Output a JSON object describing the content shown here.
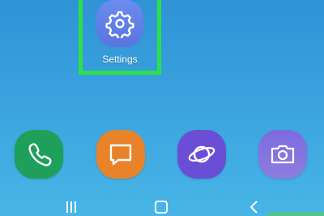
{
  "home_screen": {
    "settings_app": {
      "label": "Settings",
      "icon": "gear-icon"
    },
    "dock": [
      {
        "name": "phone",
        "icon": "phone-icon",
        "color": "#1fa05a"
      },
      {
        "name": "messages",
        "icon": "message-icon",
        "color": "#e8832a"
      },
      {
        "name": "internet",
        "icon": "planet-icon",
        "color": "#6a4fd6"
      },
      {
        "name": "camera",
        "icon": "camera-icon",
        "color": "#7b6be0"
      }
    ],
    "highlight_color": "#2de04a"
  },
  "navigation_bar": {
    "buttons": [
      "recents-icon",
      "home-icon",
      "back-icon"
    ]
  }
}
